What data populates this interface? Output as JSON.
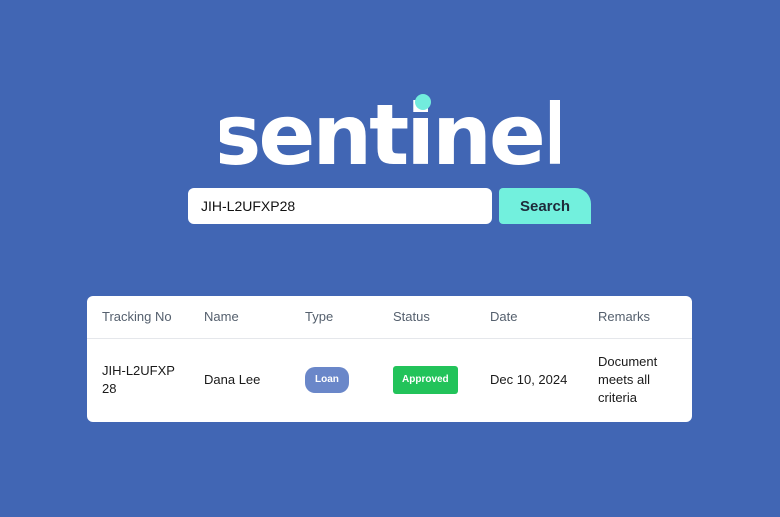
{
  "brand": {
    "name": "sentinel",
    "text_color": "#ffffff",
    "dot_color": "#72ecdd"
  },
  "search": {
    "value": "JIH-L2UFXP28",
    "placeholder": "",
    "button_label": "Search",
    "button_color": "#72f0dd"
  },
  "colors": {
    "background": "#4166b4",
    "type_badge": "#6a87c9",
    "status_approved": "#22c35a"
  },
  "table": {
    "headers": {
      "tracking_no": "Tracking No",
      "name": "Name",
      "type": "Type",
      "status": "Status",
      "date": "Date",
      "remarks": "Remarks"
    },
    "rows": [
      {
        "tracking_no": "JIH-L2UFXP28",
        "name": "Dana Lee",
        "type": "Loan",
        "status": "Approved",
        "date": "Dec 10, 2024",
        "remarks": "Document meets all criteria"
      }
    ]
  }
}
